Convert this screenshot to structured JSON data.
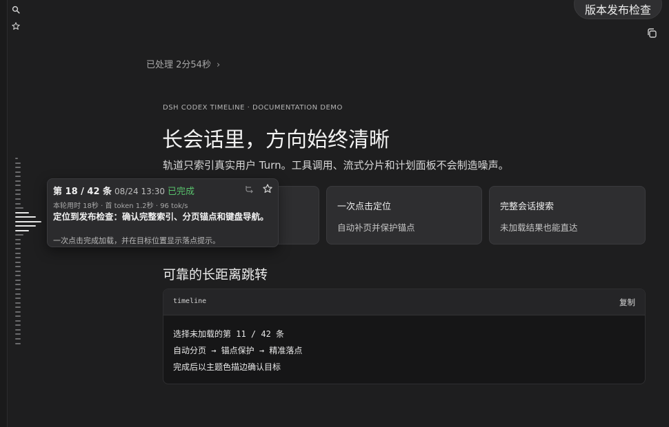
{
  "sidebar": {
    "icons": [
      {
        "name": "search-icon"
      },
      {
        "name": "star-icon"
      }
    ]
  },
  "header": {
    "release_check_label": "版本发布检查",
    "copy_icon": "copy-icon"
  },
  "processed": {
    "label": "已处理 2分54秒",
    "chevron": "›"
  },
  "hero": {
    "kicker": "DSH CODEX TIMELINE · DOCUMENTATION DEMO",
    "title": "长会话里，方向始终清晰",
    "subtitle": "轨道只索引真实用户 Turn。工具调用、流式分片和计划面板不会制造噪声。"
  },
  "cards": [
    {
      "title": "",
      "desc": ""
    },
    {
      "title": "一次点击定位",
      "desc": "自动补页并保护锚点"
    },
    {
      "title": "完整会话搜索",
      "desc": "未加载结果也能直达"
    }
  ],
  "section": {
    "title": "可靠的长距离跳转"
  },
  "code": {
    "lang": "timeline",
    "copy_label": "复制",
    "lines": [
      "选择未加载的第 11 / 42 条",
      "自动分页 → 锚点保护 → 精准落点",
      "完成后以主题色描边确认目标"
    ]
  },
  "tooltip": {
    "index": "第 18 / 42 条",
    "time": "08/24 13:30",
    "status": "已完成",
    "status_color": "#58c26c",
    "meta": "本轮用时 18秒 · 首 token 1.2秒 · 96 tok/s",
    "main": "定位到发布检查：确认完整索引、分页锚点和键盘导航。",
    "sub": "一次点击完成加载，并在目标位置显示落点提示。"
  },
  "timeline": {
    "total_turns": 42,
    "highlighted_turn": 18
  }
}
